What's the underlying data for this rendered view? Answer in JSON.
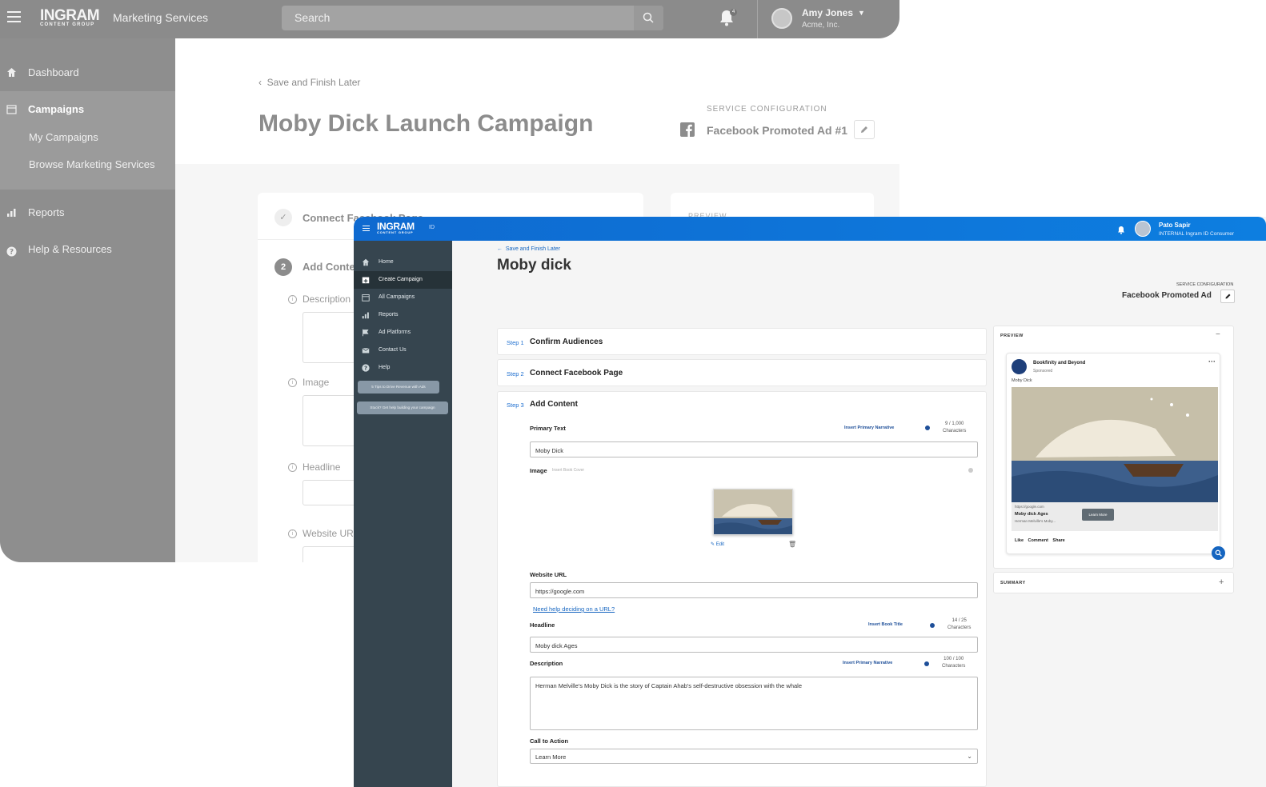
{
  "back": {
    "logo": {
      "main": "INGRAM",
      "sub": "CONTENT GROUP"
    },
    "app_title": "Marketing Services",
    "search_placeholder": "Search",
    "notification_count": "4",
    "user": {
      "name": "Amy Jones",
      "org": "Acme, Inc."
    },
    "sidebar": {
      "dashboard": "Dashboard",
      "campaigns": "Campaigns",
      "my_campaigns": "My Campaigns",
      "browse": "Browse Marketing Services",
      "reports": "Reports",
      "help": "Help & Resources"
    },
    "save_later": "Save and Finish Later",
    "title": "Moby Dick Launch Campaign",
    "service_config_label": "SERVICE CONFIGURATION",
    "service_name": "Facebook Promoted Ad #1",
    "preview_label": "PREVIEW",
    "step1_label": "Connect Facebook Page",
    "step2_num": "2",
    "step2_label": "Add Content",
    "fields": [
      "Description",
      "Image",
      "Headline",
      "Website URL"
    ]
  },
  "front": {
    "logo": {
      "main": "INGRAM",
      "sub": "CONTENT GROUP",
      "id": "ID"
    },
    "user": {
      "name": "Pato Sapir",
      "org": "INTERNAL Ingram ID Consumer"
    },
    "sidebar": {
      "items": [
        "Home",
        "Create Campaign",
        "All Campaigns",
        "Reports",
        "Ad Platforms",
        "Contact Us",
        "Help"
      ],
      "tips": "5 Tips to Drive Revenue with Ads",
      "stuck": "Stuck? Get help building your campaign"
    },
    "save_later": "Save and Finish Later",
    "title": "Moby dick",
    "service_config_label": "SERVICE CONFIGURATION",
    "service_name": "Facebook Promoted Ad",
    "steps": [
      {
        "num": "Step 1",
        "label": "Confirm Audiences"
      },
      {
        "num": "Step 2",
        "label": "Connect Facebook Page"
      },
      {
        "num": "Step 3",
        "label": "Add Content"
      }
    ],
    "form": {
      "primary_text_label": "Primary Text",
      "insert_primary_narrative": "Insert Primary Narrative",
      "primary_count": "9 / 1,000",
      "characters": "Characters",
      "primary_text_value": "Moby Dick",
      "image_label": "Image",
      "insert_book_cover": "Insert Book Cover",
      "edit": "Edit",
      "website_url_label": "Website URL",
      "website_url_value": "https://google.com",
      "url_help": "Need help deciding on a URL?",
      "headline_label": "Headline",
      "insert_book_title": "Insert Book Title",
      "headline_count": "14 / 25",
      "headline_value": "Moby dick Ages",
      "description_label": "Description",
      "description_count": "100 / 100",
      "description_value": "Herman Melville's Moby Dick is the story of Captain Ahab's self-destructive obsession with the whale",
      "cta_label": "Call to Action",
      "cta_value": "Learn More"
    },
    "preview": {
      "label": "PREVIEW",
      "page_name": "Bookfinity and Beyond",
      "sponsored": "Sponsored",
      "primary_text": "Moby Dick",
      "url": "https://google.com",
      "headline": "Moby dick Ages",
      "desc": "Herman Melville's Moby...",
      "cta": "Learn More",
      "actions": "Like Comment Share"
    },
    "summary_label": "SUMMARY"
  }
}
